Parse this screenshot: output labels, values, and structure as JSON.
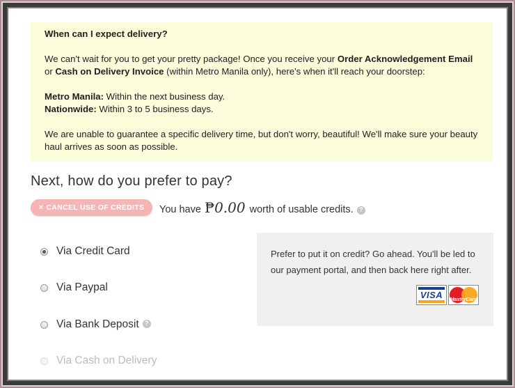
{
  "delivery_info": {
    "heading": "When can I expect delivery?",
    "para1_a": "We can't wait for you to get your pretty package! Once you receive your ",
    "para1_b": "Order Acknowledgement Email",
    "para1_c": " or ",
    "para1_d": "Cash on Delivery Invoice",
    "para1_e": " (within Metro Manila only), here's when it'll reach your doorstep:",
    "metro_label": "Metro Manila:",
    "metro_value": " Within the next business day.",
    "nationwide_label": "Nationwide:",
    "nationwide_value": " Within 3 to 5 business days.",
    "para3": "We are unable to guarantee a specific delivery time, but don't worry, beautiful! We'll make sure your beauty haul arrives as soon as possible."
  },
  "payment": {
    "heading": "Next, how do you prefer to pay?",
    "cancel_credits_label": "CANCEL USE OF CREDITS",
    "cancel_icon": "×",
    "credits_prefix": "You have",
    "credits_currency": "₱",
    "credits_amount": "0.00",
    "credits_suffix": "worth of usable credits.",
    "help_glyph": "?",
    "methods": [
      {
        "label": "Via Credit Card",
        "selected": true,
        "disabled": false
      },
      {
        "label": "Via Paypal",
        "selected": false,
        "disabled": false
      },
      {
        "label": "Via Bank Deposit",
        "selected": false,
        "disabled": false
      },
      {
        "label": "Via Cash on Delivery",
        "selected": false,
        "disabled": true
      }
    ],
    "credit_panel_text": "Prefer to put it on credit? Go ahead. You'll be led to our payment portal, and then back here right after.",
    "visa_label": "VISA",
    "mastercard_label": "MasterCard"
  },
  "colors": {
    "info_bg": "#fbfcd9",
    "cancel_button_bg": "#f7b4b4",
    "panel_bg": "#f0f0f0",
    "frame_border": "#b48a8e"
  }
}
